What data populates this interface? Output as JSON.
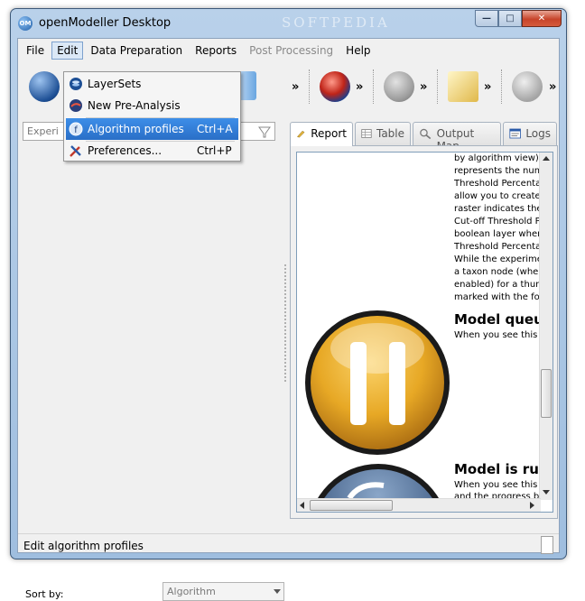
{
  "window": {
    "title": "openModeller Desktop",
    "app_icon_text": "OM",
    "watermark": "SOFTPEDIA",
    "buttons": {
      "minimize": "—",
      "maximize": "□",
      "close": "✕"
    }
  },
  "menubar": {
    "items": [
      {
        "label": "File"
      },
      {
        "label": "Edit"
      },
      {
        "label": "Data Preparation"
      },
      {
        "label": "Reports"
      },
      {
        "label": "Post Processing"
      },
      {
        "label": "Help"
      }
    ]
  },
  "edit_menu": {
    "items": [
      {
        "label": "LayerSets",
        "shortcut": ""
      },
      {
        "label": "New Pre-Analysis",
        "shortcut": ""
      },
      {
        "label": "Algorithm profiles",
        "shortcut": "Ctrl+A"
      },
      {
        "label": "Preferences...",
        "shortcut": "Ctrl+P"
      }
    ]
  },
  "toolbar": {
    "arrow": "»"
  },
  "left_panel": {
    "search_placeholder": "Experi",
    "sort_label": "Sort by:",
    "sort_value": "Algorithm"
  },
  "tabs": [
    {
      "label": "Report"
    },
    {
      "label": "Table"
    },
    {
      "label": "Output Map"
    },
    {
      "label": "Logs"
    }
  ],
  "report": {
    "lines": [
      "by algorithm view) w",
      "represents the numb",
      "Threshold Percentag",
      "allow you to create a",
      "raster indicates the",
      "Cut-off Threshold Pe",
      "boolean layer where",
      "Threshold Percentag",
      "While the experimen",
      "a taxon node (when",
      "enabled) for a thumb",
      "marked with the follo"
    ],
    "heading1": "Model queu",
    "text1": "When you see this ic",
    "heading2": "Model is ru",
    "text2a": "When you see this ic",
    "text2b": "and the progress ba"
  },
  "statusbar": {
    "text": "Edit algorithm profiles"
  },
  "colors": {
    "accent": "#2a6fc7",
    "title_bar": "#b9d1ea",
    "pause_icon": "#e7a825"
  }
}
